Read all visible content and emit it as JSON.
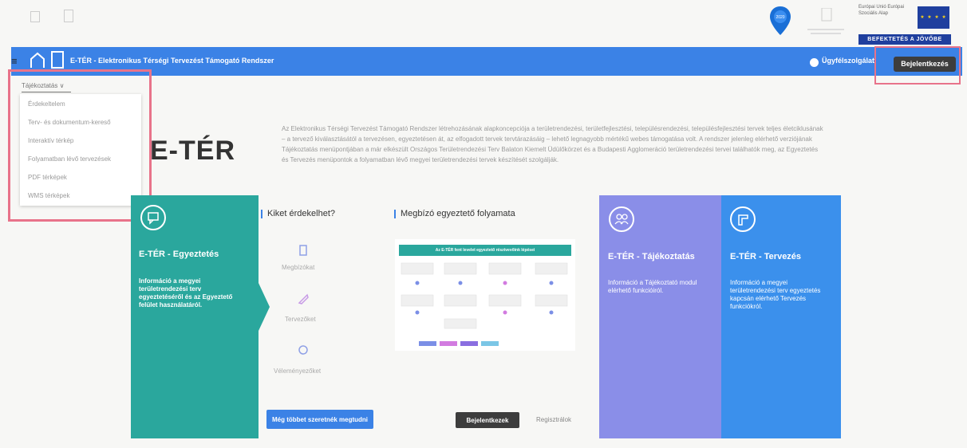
{
  "header": {
    "app_title": "E-TÉR - Elektronikus Térségi Tervezést Támogató Rendszer",
    "help_link": "Ügyfélszolgálat",
    "login_button": "Bejelentkezés",
    "eu_text": "Európai Unió Európai Szociális Alap",
    "eu_slogan": "BEFEKTETÉS A JÖVŐBE",
    "eu_stars": "★ ★ ★ ★"
  },
  "menu": {
    "tab_label": "Tájékoztatás ∨",
    "items": [
      "Érdekeltelem",
      "Terv- és dokumentum-kereső",
      "Interaktív térkép",
      "Folyamatban lévő tervezések",
      "PDF térképek",
      "WMS térképek"
    ]
  },
  "hero": {
    "title": "E-TÉR",
    "text": "Az Elektronikus Térségi Tervezést Támogató Rendszer létrehozásának alapkoncepciója a területrendezési, területfejlesztési, településrendezési, településfejlesztési tervek teljes életciklusának – a tervező kiválasztásától a tervezésen, egyeztetésen át, az elfogadott tervek tervtárazásáig – lehető legnagyobb mértékű webes támogatása volt. A rendszer jelenleg elérhető verziójának Tájékoztatás menüpontjában a már elkészült Országos Területrendezési Terv Balaton Kiemelt Üdülőkörzet és a Budapesti Agglomeráció területrendezési tervei találhatók meg, az Egyeztetés és Tervezés menüpontok a folyamatban lévő megyei területrendezési tervek készítését szolgálják."
  },
  "card_egyeztetes": {
    "title": "E-TÉR - Egyeztetés",
    "desc": "Információ a megyei területrendezési terv egyeztetéséről és az Egyeztető felület használatáról."
  },
  "who": {
    "title": "Kiket érdekelhet?",
    "items": [
      "Megbízókat",
      "Tervezőket",
      "Véleményezőket"
    ],
    "more_button": "Még többet szeretnék megtudni"
  },
  "process": {
    "title": "Megbízó egyeztető folyamata",
    "diagram_title": "Az E-TÉR fent levelet egyeztető résztvevőink lépései",
    "login_button": "Bejelentkezek",
    "register_link": "Regisztrálok"
  },
  "card_tajekoztatas": {
    "title": "E-TÉR - Tájékoztatás",
    "desc": "Információ a Tájékoztató modul elérhető funkcióiról."
  },
  "card_tervezes": {
    "title": "E-TÉR - Tervezés",
    "desc": "Információ a megyei területrendezési terv egyeztetés kapcsán elérhető Tervezés funkciókról."
  }
}
